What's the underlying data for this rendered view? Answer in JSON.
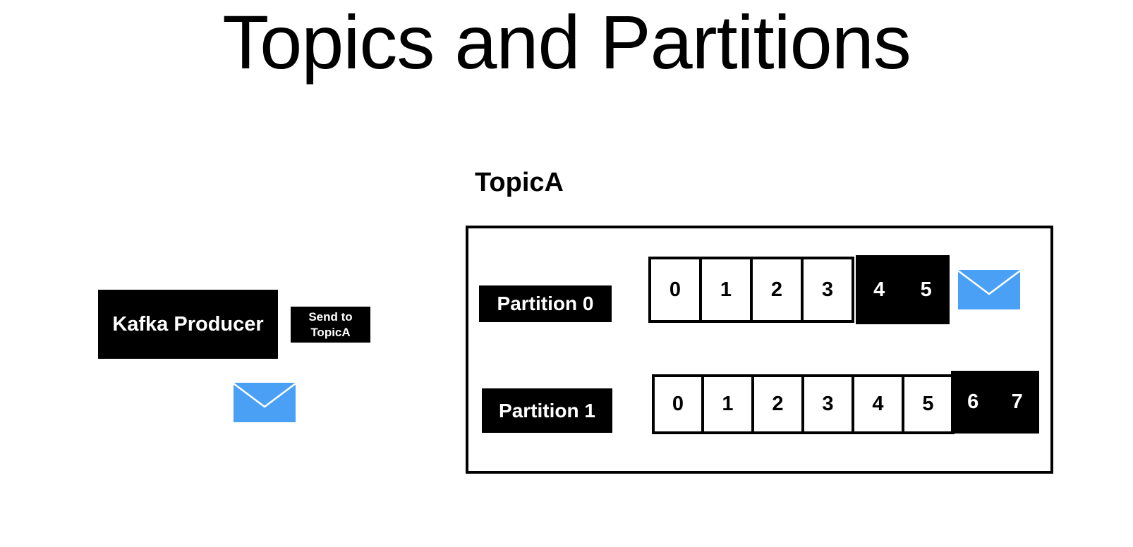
{
  "title": "Topics and Partitions",
  "producer": {
    "label": "Kafka Producer",
    "send_label_line1": "Send to",
    "send_label_line2": "TopicA"
  },
  "topic": {
    "name": "TopicA",
    "partitions": [
      {
        "label": "Partition 0",
        "committed_offsets": [
          "0",
          "1",
          "2",
          "3"
        ],
        "new_offsets": [
          "4",
          "5"
        ]
      },
      {
        "label": "Partition 1",
        "committed_offsets": [
          "0",
          "1",
          "2",
          "3",
          "4",
          "5"
        ],
        "new_offsets": [
          "6",
          "7"
        ]
      }
    ]
  },
  "colors": {
    "envelope": "#4aa0f5",
    "ink": "#000000",
    "background": "#ffffff"
  },
  "icons": [
    "message-envelope-icon"
  ]
}
